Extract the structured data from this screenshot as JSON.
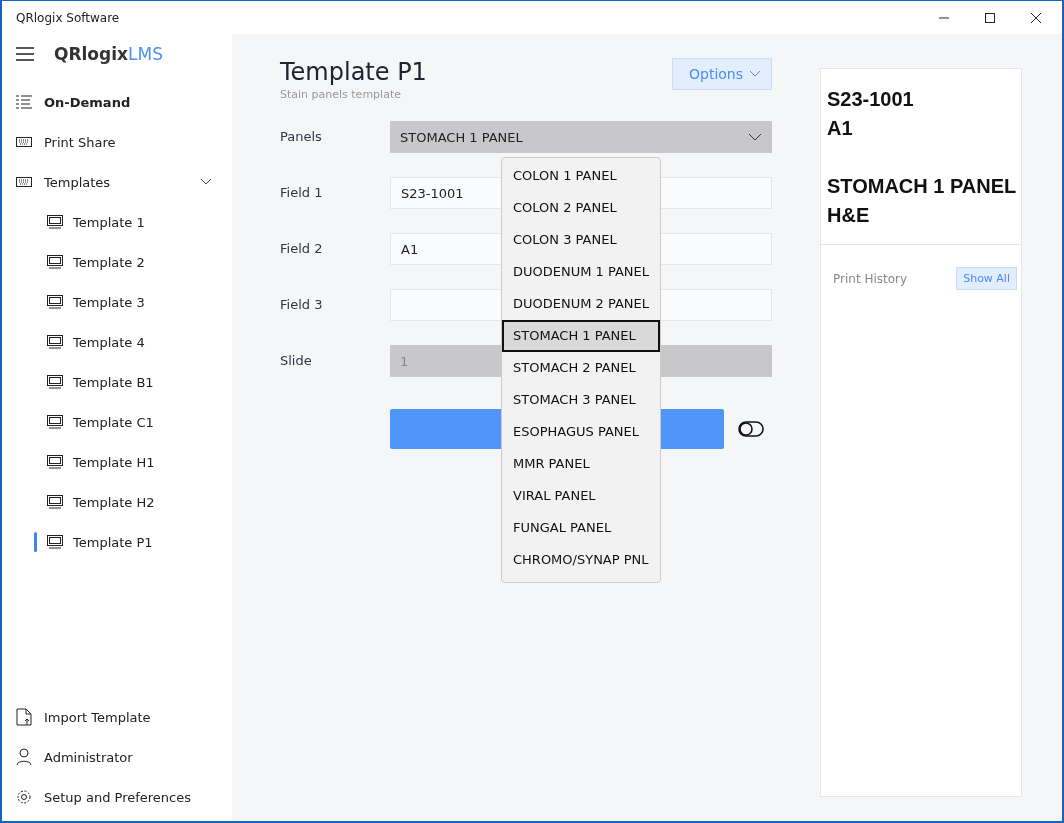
{
  "window": {
    "title": "QRlogix Software"
  },
  "sidebar": {
    "logo": {
      "name": "QRlogix",
      "suffix": "LMS"
    },
    "items": [
      {
        "label": "On-Demand",
        "kind": "list",
        "selected": true
      },
      {
        "label": "Print Share",
        "kind": "keyboard",
        "selected": false
      },
      {
        "label": "Templates",
        "kind": "keyboard",
        "selected": false,
        "expanded": true,
        "children": [
          {
            "label": "Template 1",
            "selected": false
          },
          {
            "label": "Template 2",
            "selected": false
          },
          {
            "label": "Template 3",
            "selected": false
          },
          {
            "label": "Template 4",
            "selected": false
          },
          {
            "label": "Template B1",
            "selected": false
          },
          {
            "label": "Template C1",
            "selected": false
          },
          {
            "label": "Template H1",
            "selected": false
          },
          {
            "label": "Template H2",
            "selected": false
          },
          {
            "label": "Template P1",
            "selected": true
          }
        ]
      }
    ],
    "footer": [
      {
        "label": "Import Template",
        "kind": "import"
      },
      {
        "label": "Administrator",
        "kind": "user"
      },
      {
        "label": "Setup and Preferences",
        "kind": "settings"
      }
    ]
  },
  "header": {
    "title": "Template P1",
    "subtitle": "Stain panels template",
    "options_button": "Options"
  },
  "form": [
    {
      "label": "Panels",
      "kind": "select",
      "value": "STOMACH 1 PANEL"
    },
    {
      "label": "Field 1",
      "kind": "text",
      "value": "S23-1001"
    },
    {
      "label": "Field 2",
      "kind": "text",
      "value": "A1"
    },
    {
      "label": "Field 3",
      "kind": "text"
    },
    {
      "label": "Slide",
      "kind": "disabled",
      "value": "1"
    }
  ],
  "toggle": {
    "on": false
  },
  "dropdown": [
    {
      "label": "COLON 1 PANEL",
      "selected": false
    },
    {
      "label": "COLON 2 PANEL",
      "selected": false
    },
    {
      "label": "COLON 3 PANEL",
      "selected": false
    },
    {
      "label": "DUODENUM 1 PANEL",
      "selected": false
    },
    {
      "label": "DUODENUM 2 PANEL",
      "selected": false
    },
    {
      "label": "STOMACH 1 PANEL",
      "selected": true
    },
    {
      "label": "STOMACH 2 PANEL",
      "selected": false
    },
    {
      "label": "STOMACH 3 PANEL",
      "selected": false
    },
    {
      "label": "ESOPHAGUS PANEL",
      "selected": false
    },
    {
      "label": "MMR PANEL",
      "selected": false
    },
    {
      "label": "VIRAL PANEL",
      "selected": false
    },
    {
      "label": "FUNGAL PANEL",
      "selected": false
    },
    {
      "label": "CHROMO/SYNAP PNL",
      "selected": false
    }
  ],
  "preview": {
    "blocks": [
      [
        "S23-1001",
        "A1"
      ],
      [
        "STOMACH 1 PANEL",
        "H&E"
      ]
    ],
    "history_label": "Print History",
    "show_all_button": "Show All"
  }
}
